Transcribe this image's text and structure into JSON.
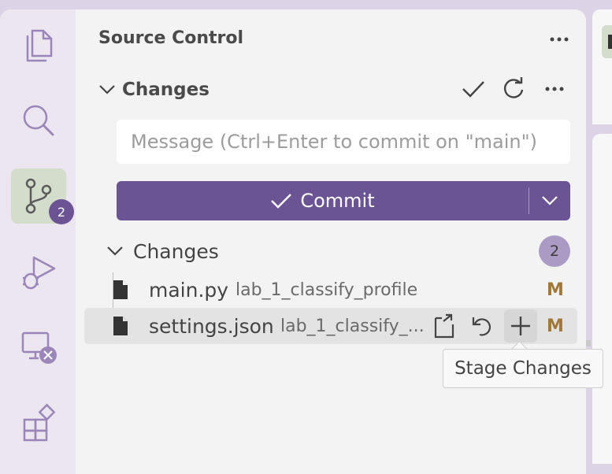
{
  "sidebar": {
    "title": "Source Control",
    "section_label": "Changes",
    "message_placeholder": "Message (Ctrl+Enter to commit on \"main\")",
    "commit_label": "Commit",
    "group": {
      "label": "Changes",
      "count": "2"
    },
    "files": [
      {
        "name": "main.py",
        "path": "lab_1_classify_profile",
        "status": "M"
      },
      {
        "name": "settings.json",
        "path": "lab_1_classify_...",
        "status": "M"
      }
    ]
  },
  "activity_bar": {
    "items": [
      "explorer-icon",
      "search-icon",
      "source-control-icon",
      "run-debug-icon",
      "remote-explorer-icon",
      "extensions-icon"
    ],
    "source_control_badge": "2"
  },
  "tooltip": "Stage Changes",
  "colors": {
    "accent": "#6b5493",
    "badge": "#6c5494",
    "count_badge": "#a99bc4",
    "modified": "#a0783a",
    "active_item_bg": "#d4dccc"
  }
}
